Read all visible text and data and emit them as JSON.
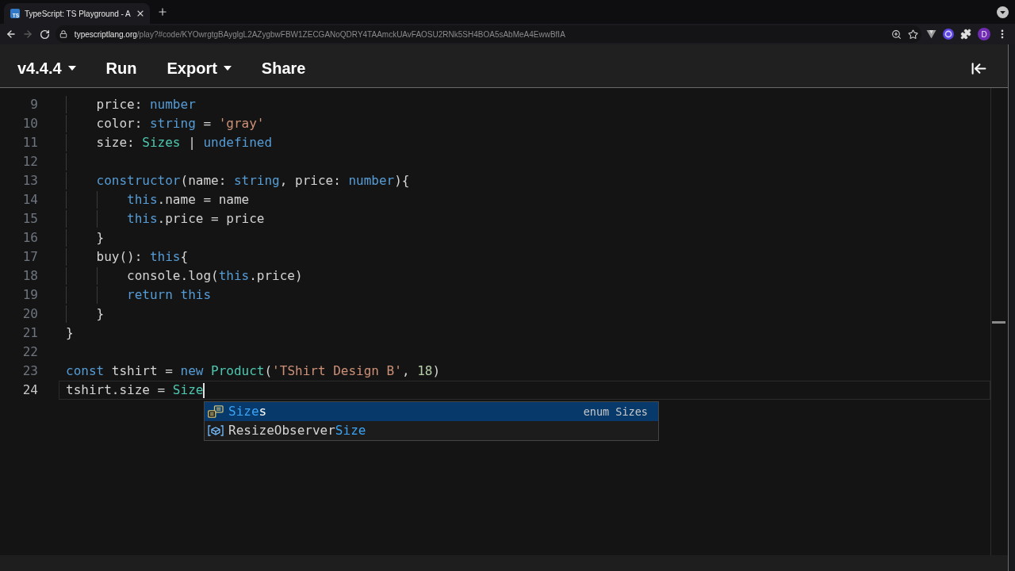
{
  "browser": {
    "tabs": [
      {
        "favicon": "TS",
        "title": "TypeScript: TS Playground - A",
        "selected": true
      }
    ],
    "back_disabled": false,
    "forward_disabled": true,
    "url_host": "typescriptlang.org",
    "url_path": "/play?#code/KYOwrgtgBAyglgL2AZygbwFBW1ZECGANoQDRY4TAAmckUAvFAOSU2RNk5SH4BOA5sAbMeA4EwwBfIA",
    "profile_initial": "D"
  },
  "toolbar": {
    "items": [
      {
        "label": "v4.4.4",
        "kind": "dropdown"
      },
      {
        "label": "Run",
        "kind": "button"
      },
      {
        "label": "Export",
        "kind": "dropdown"
      },
      {
        "label": "Share",
        "kind": "button"
      }
    ]
  },
  "editor": {
    "body": [
      {
        "number": "9",
        "current": false,
        "tokens": [
          {
            "kind": "plain",
            "text": "price: "
          },
          {
            "kind": "keyword",
            "text": "number"
          }
        ]
      },
      {
        "number": "10",
        "current": false,
        "tokens": [
          {
            "kind": "plain",
            "text": "color: "
          },
          {
            "kind": "keyword",
            "text": "string"
          },
          {
            "kind": "plain",
            "text": " = "
          },
          {
            "kind": "string",
            "text": "'gray'"
          }
        ]
      },
      {
        "number": "11",
        "current": false,
        "tokens": [
          {
            "kind": "plain",
            "text": "size: "
          },
          {
            "kind": "type",
            "text": "Sizes"
          },
          {
            "kind": "plain",
            "text": " | "
          },
          {
            "kind": "keyword",
            "text": "undefined"
          }
        ]
      },
      {
        "number": "12",
        "current": false
      },
      {
        "number": "13",
        "current": false,
        "tokens": [
          {
            "kind": "keyword",
            "text": "constructor"
          },
          {
            "kind": "plain",
            "text": "(name: "
          },
          {
            "kind": "keyword",
            "text": "string"
          },
          {
            "kind": "plain",
            "text": ", price: "
          },
          {
            "kind": "keyword",
            "text": "number"
          },
          {
            "kind": "plain",
            "text": "){"
          }
        ],
        "children": [
          {
            "number": "14",
            "current": false,
            "tokens": [
              {
                "kind": "keyword",
                "text": "this"
              },
              {
                "kind": "plain",
                "text": ".name = name"
              }
            ]
          },
          {
            "number": "15",
            "current": false,
            "tokens": [
              {
                "kind": "keyword",
                "text": "this"
              },
              {
                "kind": "plain",
                "text": ".price = price"
              }
            ]
          }
        ]
      },
      {
        "number": "16",
        "current": false,
        "tokens": [
          {
            "kind": "plain",
            "text": "}"
          }
        ]
      },
      {
        "number": "17",
        "current": false,
        "tokens": [
          {
            "kind": "plain",
            "text": "buy(): "
          },
          {
            "kind": "keyword",
            "text": "this"
          },
          {
            "kind": "plain",
            "text": "{"
          }
        ],
        "children": [
          {
            "number": "18",
            "current": false,
            "tokens": [
              {
                "kind": "plain",
                "text": "console.log("
              },
              {
                "kind": "keyword",
                "text": "this"
              },
              {
                "kind": "plain",
                "text": ".price)"
              }
            ]
          },
          {
            "number": "19",
            "current": false,
            "tokens": [
              {
                "kind": "keyword",
                "text": "return this"
              }
            ]
          }
        ]
      },
      {
        "number": "20",
        "current": false,
        "tokens": [
          {
            "kind": "plain",
            "text": "}"
          }
        ]
      }
    ],
    "lines": [
      {
        "number": "21",
        "current": false,
        "tokens": [
          {
            "kind": "plain",
            "text": "}"
          }
        ]
      },
      {
        "number": "22",
        "current": false
      },
      {
        "number": "23",
        "current": false,
        "tokens": [
          {
            "kind": "keyword",
            "text": "const"
          },
          {
            "kind": "plain",
            "text": " tshirt = "
          },
          {
            "kind": "keyword",
            "text": "new"
          },
          {
            "kind": "type",
            "text": " Product"
          },
          {
            "kind": "plain",
            "text": "("
          },
          {
            "kind": "string",
            "text": "'TShirt Design B'"
          },
          {
            "kind": "plain",
            "text": ", "
          },
          {
            "kind": "number",
            "text": "18"
          },
          {
            "kind": "plain",
            "text": ")"
          }
        ]
      },
      {
        "number": "24",
        "current": true,
        "tokens": [
          {
            "kind": "plain",
            "text": "tshirt.size = "
          },
          {
            "kind": "type",
            "text": "Size"
          }
        ]
      }
    ],
    "suggestions": [
      {
        "kind": "enum",
        "selected": true,
        "parts": [
          {
            "text": "Size",
            "match": true
          },
          {
            "text": "s",
            "match": false
          }
        ],
        "detail": "enum Sizes"
      },
      {
        "kind": "variable",
        "selected": false,
        "parts": [
          {
            "text": "ResizeObserver",
            "match": false
          },
          {
            "text": "Size",
            "match": true
          }
        ]
      }
    ]
  }
}
